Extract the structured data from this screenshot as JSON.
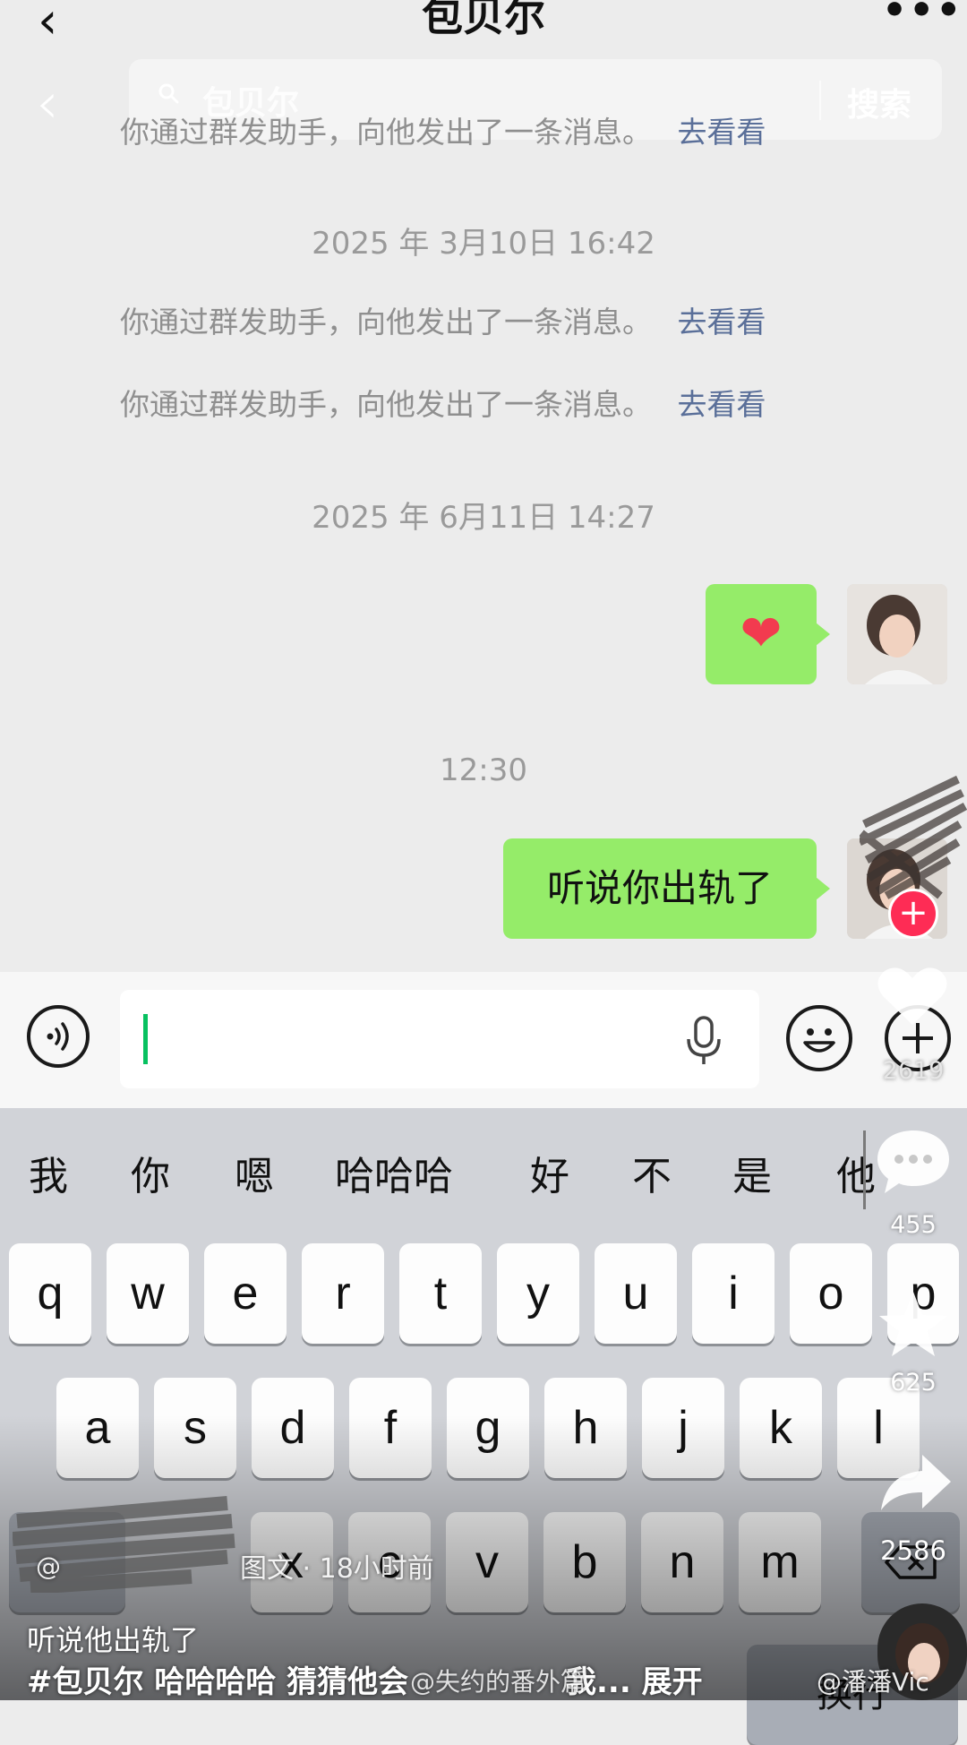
{
  "header": {
    "back_icon": "‹",
    "title": "包贝尔",
    "more_icon": "•••"
  },
  "search": {
    "back_icon": "‹",
    "query": "包贝尔",
    "button_label": "搜索"
  },
  "chat": {
    "system_messages": [
      {
        "text": "你通过群发助手，向他发出了一条消息。",
        "link": "去看看"
      },
      {
        "text": "你通过群发助手，向他发出了一条消息。",
        "link": "去看看"
      },
      {
        "text": "你通过群发助手，向他发出了一条消息。",
        "link": "去看看"
      }
    ],
    "timestamps": [
      "2025 年 3月10日 16:42",
      "2025 年 6月11日 14:27",
      "12:30"
    ],
    "messages": [
      {
        "type": "emoji",
        "content": "❤"
      },
      {
        "type": "text",
        "content": "听说你出轨了"
      }
    ]
  },
  "input_bar": {
    "voice_icon": "voice-icon",
    "mic_icon": "mic-icon",
    "emoji_icon": "emoji-icon",
    "plus_icon": "plus-icon"
  },
  "keyboard": {
    "candidates": [
      "我",
      "你",
      "嗯",
      "哈哈哈",
      "好",
      "不",
      "是",
      "他"
    ],
    "row1": [
      "q",
      "w",
      "e",
      "r",
      "t",
      "y",
      "u",
      "i",
      "o",
      "p"
    ],
    "row2": [
      "a",
      "s",
      "d",
      "f",
      "g",
      "h",
      "j",
      "k",
      "l"
    ],
    "row3": [
      "x",
      "c",
      "v",
      "b",
      "n",
      "m"
    ],
    "return_label": "换行"
  },
  "overlay": {
    "comment_count": "455",
    "favorite_count": "625",
    "share_count": "2586",
    "like_count": "2619",
    "post_meta": "图文 · 18小时前",
    "caption_line1": "听说他出轨了",
    "caption_line2": "#包贝尔 哈哈哈哈 猜猜他会",
    "caption_more": "我... 展开",
    "watermark_left": "@失约的番外篇",
    "watermark_right": "@潘潘Vic",
    "colors": {
      "accent_green": "#07c160",
      "bubble_green": "#95ec69",
      "link_blue": "#5a6f99",
      "follow_red": "#fe2c55"
    }
  }
}
